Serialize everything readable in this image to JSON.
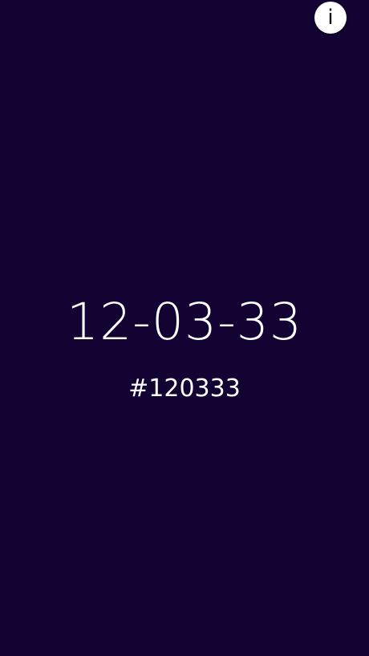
{
  "colors": {
    "background": "#120333",
    "text": "#ffffff",
    "info_button_bg": "#ffffff",
    "info_button_glyph": "#111111"
  },
  "info_button": {
    "icon": "info-icon",
    "glyph": "i"
  },
  "clock": {
    "time_display": "12-03-33",
    "hex_display": "#120333"
  }
}
